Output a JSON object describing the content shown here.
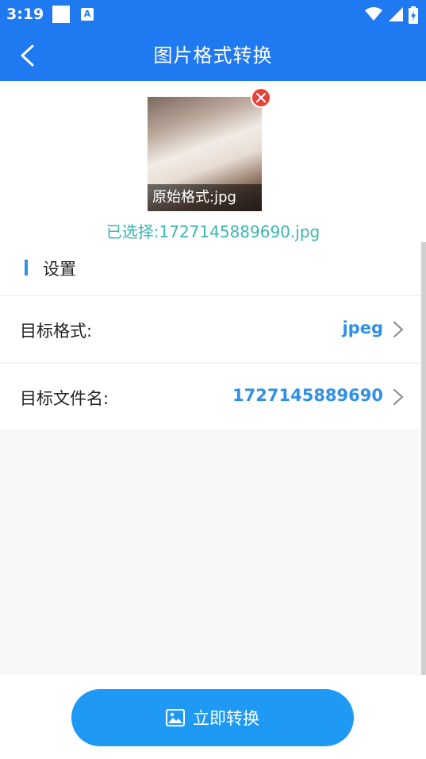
{
  "status_bar": {
    "time": "3:19",
    "icons": [
      "square-notification-icon",
      "a-notification-icon",
      "wifi-icon",
      "cell-signal-icon",
      "battery-charging-icon"
    ]
  },
  "app_bar": {
    "title": "图片格式转换",
    "back_icon": "back-arrow-icon"
  },
  "image_preview": {
    "caption": "原始格式:jpg",
    "remove_icon": "close-circle-icon",
    "selected_text": "已选择:1727145889690.jpg"
  },
  "settings": {
    "title": "设置",
    "rows": [
      {
        "label": "目标格式:",
        "value": "jpeg"
      },
      {
        "label": "目标文件名:",
        "value": "1727145889690"
      }
    ]
  },
  "action": {
    "convert_label": "立即转换",
    "convert_icon": "image-icon"
  },
  "colors": {
    "app_bar": "#1f79f0",
    "accent": "#2f90e8",
    "button": "#1e9af5",
    "selected_text": "#3cb6b1",
    "remove": "#e8413a"
  }
}
